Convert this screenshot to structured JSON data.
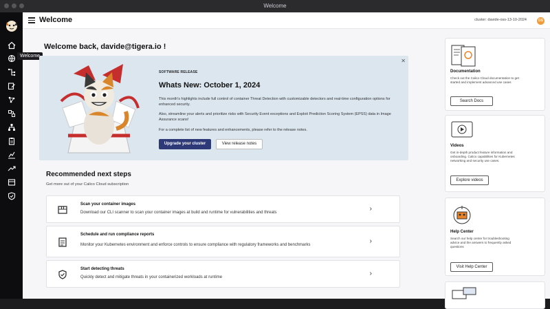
{
  "window": {
    "title": "Welcome"
  },
  "header": {
    "title": "Welcome",
    "cluster_label": "cluster: davide-oss-13-10-2024",
    "avatar_initials": "DS"
  },
  "sidebar": {
    "tooltip": "Welcome"
  },
  "main": {
    "welcome_heading": "Welcome back, davide@tigera.io !",
    "banner": {
      "tag": "SOFTWARE RELEASE",
      "title": "Whats New: October 1, 2024",
      "p1": "This month's highlights include full control of container Threat Detection with customizable detectors and real-time configuration options for enhanced security.",
      "p2": "Also, streamline your alerts and prioritize risks with Security Event exceptions and Exploit Prediction Scoring System (EPSS) data in Image Assurance scans!",
      "p3": "For a complete list of new features and enhancements, please refer to the release notes.",
      "primary_button": "Upgrade your cluster",
      "secondary_button": "View release notes"
    },
    "recommended": {
      "title": "Recommended next steps",
      "subtitle": "Get more out of your Calico Cloud subscription",
      "items": [
        {
          "title": "Scan your container images",
          "desc": "Download our CLI scanner to scan your container images at build and runtime for vulnerabilities and threats"
        },
        {
          "title": "Schedule and run compliance reports",
          "desc": "Monitor your Kubernetes environment and enforce controls to ensure compliance with regulatory frameworks and benchmarks"
        },
        {
          "title": "Start detecting threats",
          "desc": "Quickly detect and mitigate threats in your containerized workloads at runtime"
        }
      ]
    }
  },
  "right": {
    "docs": {
      "title": "Documentation",
      "desc": "Check out the Calico Cloud documentation to get started and implement advanced use cases",
      "button": "Search Docs"
    },
    "videos": {
      "title": "Videos",
      "desc": "Get in-depth product feature information and onboarding. Calico capabilities for Kubernetes networking and security use cases.",
      "button": "Explore videos"
    },
    "help": {
      "title": "Help Center",
      "desc": "Search our help center for troubleshooting advice and the answers to frequently asked questions",
      "button": "Visit Help Center"
    }
  },
  "colors": {
    "primary": "#2e3a78",
    "banner_bg": "#dbe6ef",
    "sidebar_bg": "#0d0d10",
    "avatar": "#f29b3b"
  }
}
